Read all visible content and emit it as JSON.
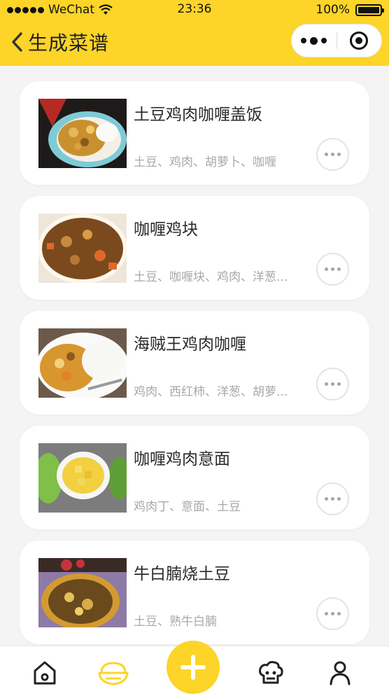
{
  "status_bar": {
    "carrier": "WeChat",
    "time": "23:36",
    "battery": "100%"
  },
  "nav": {
    "title": "生成菜谱"
  },
  "recipes": [
    {
      "name": "土豆鸡肉咖喱盖饭",
      "ingredients": "土豆、鸡肉、胡萝卜、咖喱"
    },
    {
      "name": "咖喱鸡块",
      "ingredients": "土豆、咖喱块、鸡肉、洋葱..."
    },
    {
      "name": "海贼王鸡肉咖喱",
      "ingredients": "鸡肉、西红柿、洋葱、胡萝..."
    },
    {
      "name": "咖喱鸡肉意面",
      "ingredients": "鸡肉丁、意面、土豆"
    },
    {
      "name": "牛白腩烧土豆",
      "ingredients": "土豆、熟牛白腩"
    }
  ],
  "tabbar": {
    "items": [
      "home-icon",
      "rice-bowl-icon",
      "add-icon",
      "chef-icon",
      "profile-icon"
    ],
    "active": "rice-bowl-icon"
  },
  "colors": {
    "brand": "#fdd428",
    "text": "#2a2a2a",
    "muted": "#a8a8a8"
  }
}
